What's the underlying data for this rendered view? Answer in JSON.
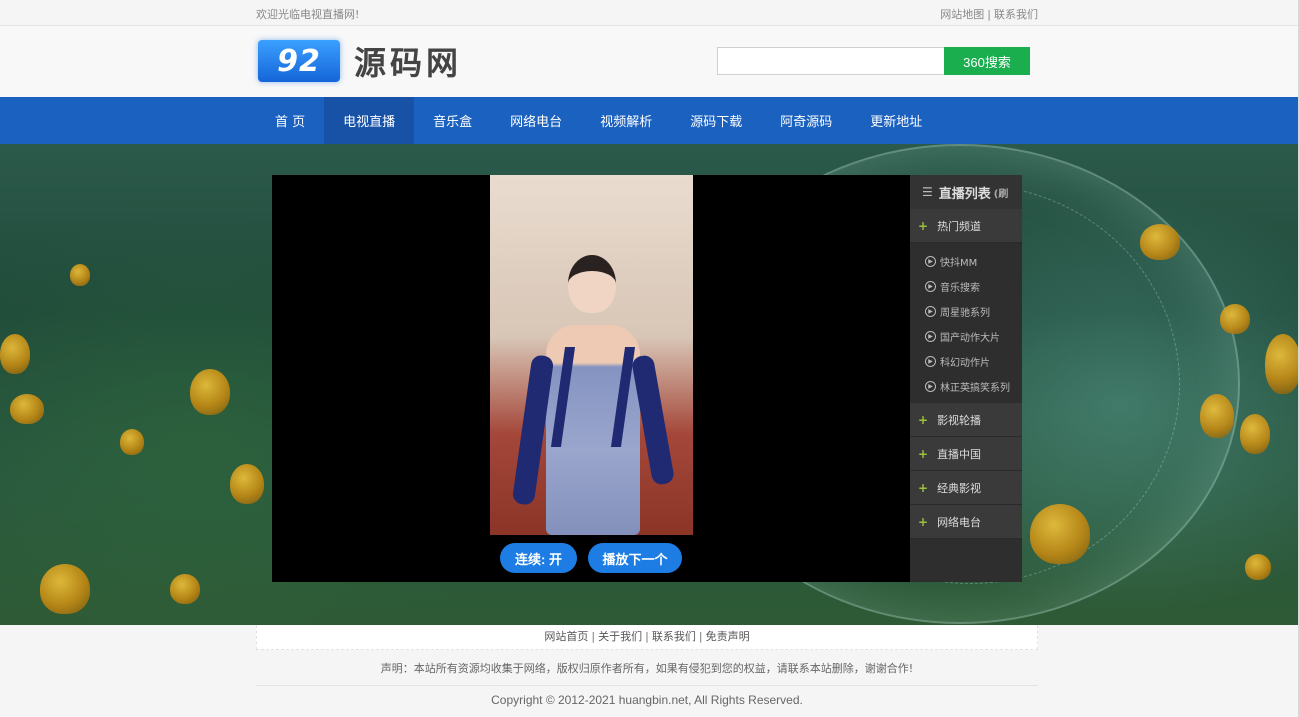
{
  "topbar": {
    "welcome": "欢迎光临电视直播网!",
    "links": [
      "网站地图",
      "联系我们"
    ],
    "separator": "|"
  },
  "header": {
    "logo_mark": "92",
    "logo_text": "源码网",
    "search": {
      "value": "",
      "placeholder": ""
    },
    "search_button": "360搜索"
  },
  "nav": {
    "items": [
      "首 页",
      "电视直播",
      "音乐盒",
      "网络电台",
      "视频解析",
      "源码下载",
      "阿奇源码",
      "更新地址"
    ],
    "active_index": 1
  },
  "player": {
    "loop_button": "连续: 开",
    "next_button": "播放下一个"
  },
  "playlist": {
    "title": "直播列表",
    "title_suffix": "(刷",
    "groups": [
      {
        "label": "热门频道",
        "expanded": true,
        "items": [
          "快抖MM",
          "音乐搜索",
          "周星驰系列",
          "国产动作大片",
          "科幻动作片",
          "林正英搞笑系列"
        ]
      },
      {
        "label": "影视轮播"
      },
      {
        "label": "直播中国"
      },
      {
        "label": "经典影视"
      },
      {
        "label": "网络电台"
      }
    ]
  },
  "footer": {
    "links": [
      "网站首页",
      "关于我们",
      "联系我们",
      "免责声明"
    ],
    "separator": "|",
    "notice": "声明：本站所有资源均收集于网络，版权归原作者所有，如果有侵犯到您的权益，请联系本站删除，谢谢合作!",
    "copyright": "Copyright © 2012-2021 huangbin.net, All Rights Reserved."
  },
  "colors": {
    "nav_bg": "#1b61c0",
    "nav_active": "#1752a7",
    "search_button": "#1aae4f",
    "player_button": "#1e7de4",
    "playlist_bg": "#2e2e2e",
    "playlist_plus": "#9cc13a"
  }
}
